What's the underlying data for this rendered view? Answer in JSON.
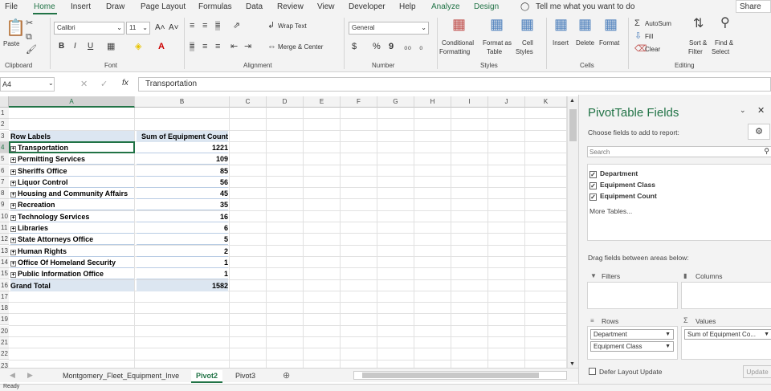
{
  "ribbon_tabs": [
    "File",
    "Home",
    "Insert",
    "Draw",
    "Page Layout",
    "Formulas",
    "Data",
    "Review",
    "View",
    "Developer",
    "Help",
    "Analyze",
    "Design"
  ],
  "tell_me": "Tell me what you want to do",
  "share": "Share",
  "ribbon": {
    "clipboard": {
      "paste": "Paste",
      "label": "Clipboard"
    },
    "font": {
      "name": "Calibri",
      "size": "11",
      "label": "Font",
      "bold": "B",
      "italic": "I",
      "underline": "U",
      "grow": "A˄",
      "shrink": "A˅"
    },
    "alignment": {
      "wrap": "Wrap Text",
      "merge": "Merge & Center",
      "label": "Alignment"
    },
    "number": {
      "format": "General",
      "currency": "$",
      "percent": "%",
      "comma": "9",
      "label": "Number"
    },
    "styles": {
      "cond": "Conditional",
      "cond2": "Formatting",
      "fmt_table": "Format as",
      "fmt_table2": "Table",
      "cell_styles": "Cell",
      "cell_styles2": "Styles",
      "label": "Styles"
    },
    "cells": {
      "insert": "Insert",
      "delete": "Delete",
      "format": "Format",
      "label": "Cells"
    },
    "editing": {
      "autosum": "AutoSum",
      "fill": "Fill",
      "clear": "Clear",
      "sort": "Sort &",
      "sort2": "Filter",
      "find": "Find &",
      "find2": "Select",
      "label": "Editing"
    }
  },
  "formula_bar": {
    "name_box": "A4",
    "fx": "fx",
    "value": "Transportation"
  },
  "columns": [
    "A",
    "B",
    "C",
    "D",
    "E",
    "F",
    "G",
    "H",
    "I",
    "J",
    "K"
  ],
  "rows": [
    "1",
    "2",
    "3",
    "4",
    "5",
    "6",
    "7",
    "8",
    "9",
    "10",
    "11",
    "12",
    "13",
    "14",
    "15",
    "16",
    "17",
    "18",
    "19",
    "20",
    "21",
    "22",
    "23"
  ],
  "pivot": {
    "header_a": "Row Labels",
    "header_b": "Sum of Equipment Count",
    "rows": [
      {
        "label": "Transportation",
        "value": "1221"
      },
      {
        "label": "Permitting Services",
        "value": "109"
      },
      {
        "label": "Sheriffs Office",
        "value": "85"
      },
      {
        "label": "Liquor Control",
        "value": "56"
      },
      {
        "label": "Housing and Community Affairs",
        "value": "45"
      },
      {
        "label": "Recreation",
        "value": "35"
      },
      {
        "label": "Technology Services",
        "value": "16"
      },
      {
        "label": "Libraries",
        "value": "6"
      },
      {
        "label": "State Attorneys Office",
        "value": "5"
      },
      {
        "label": "Human Rights",
        "value": "2"
      },
      {
        "label": "Office Of Homeland Security",
        "value": "1"
      },
      {
        "label": "Public Information Office",
        "value": "1"
      }
    ],
    "total_label": "Grand Total",
    "total_value": "1582"
  },
  "sheet_tabs": [
    "Montgomery_Fleet_Equipment_Inve",
    "Pivot2",
    "Pivot3"
  ],
  "active_sheet": "Pivot2",
  "status": "Ready",
  "pane": {
    "title": "PivotTable Fields",
    "choose": "Choose fields to add to report:",
    "search_placeholder": "Search",
    "fields": [
      "Department",
      "Equipment Class",
      "Equipment Count"
    ],
    "more_tables": "More Tables...",
    "drag_text": "Drag fields between areas below:",
    "filters": "Filters",
    "columns": "Columns",
    "rows_label": "Rows",
    "values_label": "Values",
    "row_fields": [
      "Department",
      "Equipment Class"
    ],
    "value_fields": [
      "Sum of Equipment Co..."
    ],
    "defer": "Defer Layout Update",
    "update": "Update"
  },
  "accent": "#217346"
}
